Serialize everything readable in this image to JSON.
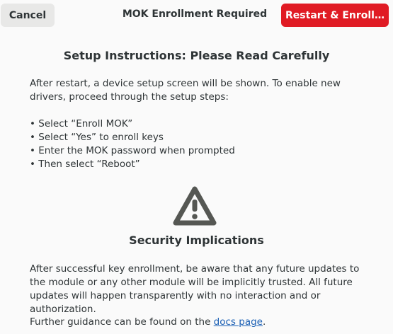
{
  "header": {
    "cancel_label": "Cancel",
    "title": "MOK Enrollment Required",
    "restart_label": "Restart & Enroll…"
  },
  "setup": {
    "title": "Setup Instructions: Please Read Carefully",
    "intro": "After restart, a device setup screen will be shown. To enable new drivers, proceed through the setup steps:",
    "steps": [
      "Select “Enroll MOK”",
      "Select “Yes” to enroll keys",
      "Enter the MOK password when prompted",
      "Then select “Reboot”"
    ]
  },
  "security": {
    "icon": "warning-icon",
    "title": "Security Implications",
    "body": "After successful key enrollment, be aware that any future updates to the module or any other module will be implicitly trusted. All future updates will happen transparently with no interaction and or authorization.",
    "further_prefix": "Further guidance can be found on the ",
    "link_label": "docs page",
    "further_suffix": "."
  },
  "colors": {
    "destructive": "#e01b24",
    "link": "#1a5fb4",
    "icon": "#555753"
  }
}
